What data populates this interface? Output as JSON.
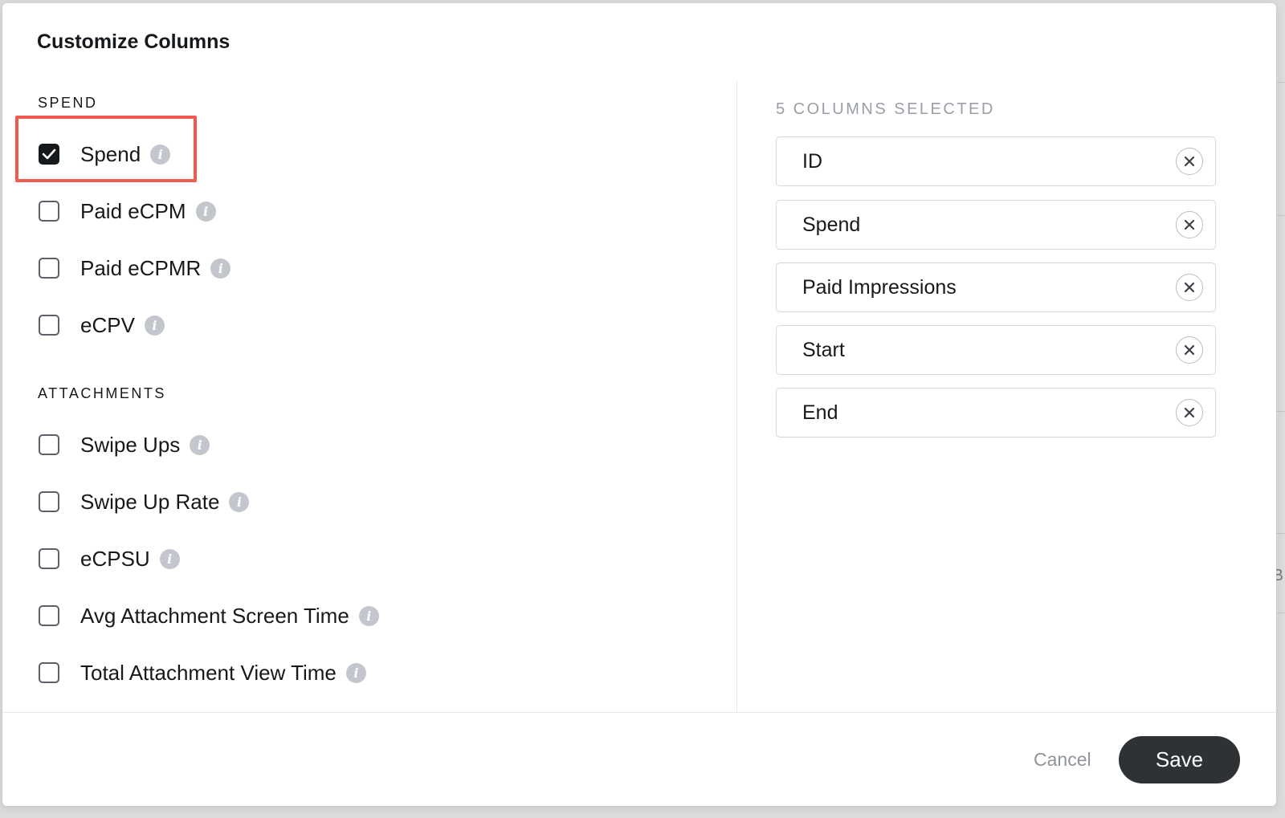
{
  "dialog": {
    "title": "Customize Columns"
  },
  "sections": [
    {
      "header": "SPEND",
      "options": [
        {
          "label": "Spend",
          "checked": true
        },
        {
          "label": "Paid eCPM",
          "checked": false
        },
        {
          "label": "Paid eCPMR",
          "checked": false
        },
        {
          "label": "eCPV",
          "checked": false
        }
      ]
    },
    {
      "header": "ATTACHMENTS",
      "options": [
        {
          "label": "Swipe Ups",
          "checked": false
        },
        {
          "label": "Swipe Up Rate",
          "checked": false
        },
        {
          "label": "eCPSU",
          "checked": false
        },
        {
          "label": "Avg Attachment Screen Time",
          "checked": false
        },
        {
          "label": "Total Attachment View Time",
          "checked": false
        }
      ]
    }
  ],
  "selected": {
    "header": "5 COLUMNS SELECTED",
    "columns": [
      "ID",
      "Spend",
      "Paid Impressions",
      "Start",
      "End"
    ]
  },
  "footer": {
    "cancel_label": "Cancel",
    "save_label": "Save"
  },
  "colors": {
    "highlight": "#f05a4f",
    "primary_button": "#2f3235",
    "text": "#16191c",
    "muted_text": "#9a9fa7"
  },
  "icons": {
    "info": "info-icon",
    "checkmark": "checkmark-icon",
    "remove": "close-icon"
  }
}
